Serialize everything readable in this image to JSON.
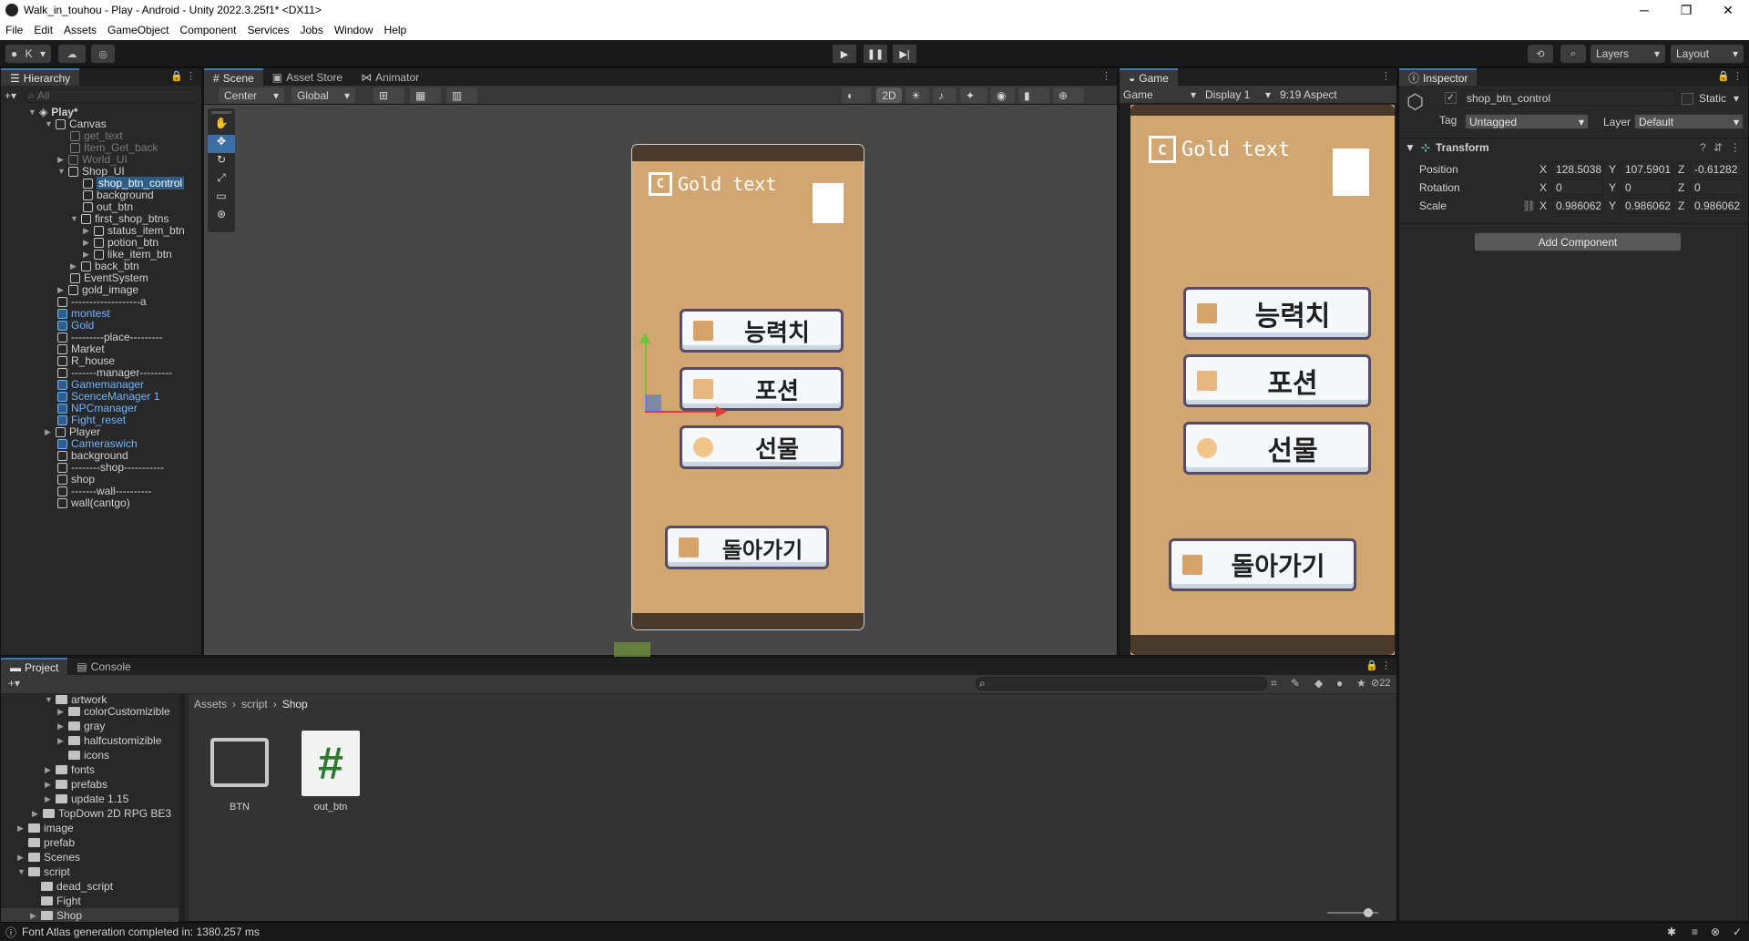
{
  "window": {
    "title": "Walk_in_touhou - Play - Android - Unity 2022.3.25f1* <DX11>",
    "controls": [
      "─",
      "❐",
      "✕"
    ]
  },
  "menu": [
    "File",
    "Edit",
    "Assets",
    "GameObject",
    "Component",
    "Services",
    "Jobs",
    "Window",
    "Help"
  ],
  "toolbar": {
    "account_label": "K",
    "layers_label": "Layers",
    "layout_label": "Layout"
  },
  "hierarchy": {
    "tab": "Hierarchy",
    "search_placeholder": "All",
    "scene_name": "Play*",
    "items": [
      {
        "label": "Canvas"
      },
      {
        "label": "get_text"
      },
      {
        "label": "Item_Get_back"
      },
      {
        "label": "World_UI"
      },
      {
        "label": "Shop_UI"
      },
      {
        "label": "shop_btn_control"
      },
      {
        "label": "background"
      },
      {
        "label": "out_btn"
      },
      {
        "label": "first_shop_btns"
      },
      {
        "label": "status_item_btn"
      },
      {
        "label": "potion_btn"
      },
      {
        "label": "like_item_btn"
      },
      {
        "label": "back_btn"
      },
      {
        "label": "EventSystem"
      },
      {
        "label": "gold_image"
      },
      {
        "label": "-------------------a"
      },
      {
        "label": "montest"
      },
      {
        "label": "Gold"
      },
      {
        "label": "---------place---------"
      },
      {
        "label": "Market"
      },
      {
        "label": "R_house"
      },
      {
        "label": "-------manager---------"
      },
      {
        "label": "Gamemanager"
      },
      {
        "label": "ScenceManager 1"
      },
      {
        "label": "NPCmanager"
      },
      {
        "label": "Fight_reset"
      },
      {
        "label": "Player"
      },
      {
        "label": "Cameraswich"
      },
      {
        "label": "background"
      },
      {
        "label": "--------shop-----------"
      },
      {
        "label": "shop"
      },
      {
        "label": "-------wall----------"
      },
      {
        "label": "wall(cantgo)"
      }
    ]
  },
  "scene": {
    "tabs": [
      "Scene",
      "Asset Store",
      "Animator"
    ],
    "pivot": "Center",
    "space": "Global",
    "mode_2d": "2D"
  },
  "game": {
    "tab": "Game",
    "view": "Game",
    "display": "Display 1",
    "aspect": "9:19 Aspect"
  },
  "shop_ui": {
    "gold_label": "Gold text",
    "buttons": [
      "능력치",
      "포션",
      "선물"
    ],
    "back": "돌아가기"
  },
  "inspector": {
    "tab": "Inspector",
    "object_name": "shop_btn_control",
    "static_label": "Static",
    "tag_label": "Tag",
    "tag_value": "Untagged",
    "layer_label": "Layer",
    "layer_value": "Default",
    "component": "Transform",
    "position_label": "Position",
    "rotation_label": "Rotation",
    "scale_label": "Scale",
    "position": {
      "x": "128.5038",
      "y": "107.5901",
      "z": "-0.61282"
    },
    "rotation": {
      "x": "0",
      "y": "0",
      "z": "0"
    },
    "scale": {
      "x": "0.986062",
      "y": "0.986062",
      "z": "0.986062"
    },
    "add_component": "Add Component"
  },
  "project": {
    "tabs": [
      "Project",
      "Console"
    ],
    "tree": [
      {
        "label": "artwork"
      },
      {
        "label": "colorCustomizible"
      },
      {
        "label": "gray"
      },
      {
        "label": "halfcustomizible"
      },
      {
        "label": "icons"
      },
      {
        "label": "fonts"
      },
      {
        "label": "prefabs"
      },
      {
        "label": "update 1.15"
      },
      {
        "label": "TopDown 2D RPG BE3"
      },
      {
        "label": "image"
      },
      {
        "label": "prefab"
      },
      {
        "label": "Scenes"
      },
      {
        "label": "script"
      },
      {
        "label": "dead_script"
      },
      {
        "label": "Fight"
      },
      {
        "label": "Shop"
      }
    ],
    "breadcrumb": [
      "Assets",
      "script",
      "Shop"
    ],
    "assets": [
      {
        "label": "BTN",
        "kind": "folder"
      },
      {
        "label": "out_btn",
        "kind": "script"
      }
    ],
    "hidden_count": "22"
  },
  "status": {
    "message": "Font Atlas generation completed in: 1380.257 ms"
  }
}
